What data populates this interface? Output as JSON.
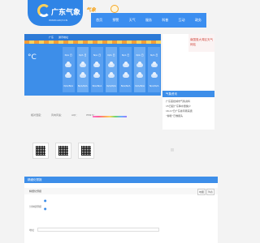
{
  "header": {
    "logo_text": "广东气象",
    "logo_url": "WWW.GDQY.CN",
    "promo_text": "气象"
  },
  "nav": {
    "items": [
      {
        "label": "首页"
      },
      {
        "label": "预警"
      },
      {
        "label": "天气"
      },
      {
        "label": "服务"
      },
      {
        "label": "科普"
      },
      {
        "label": "互动"
      },
      {
        "label": "政务"
      }
    ]
  },
  "weather": {
    "location": "广东",
    "location_sub": "通讯地址",
    "temperature": "°C",
    "columns": [
      {
        "top": "N/A 日",
        "bottom": "N/A/N/A"
      },
      {
        "top": "N/A 日",
        "bottom": "N/A/N/A"
      },
      {
        "top": "N/A 日",
        "bottom": "N/A/N/A"
      },
      {
        "top": "N/A 日",
        "bottom": "N/A/N/A"
      },
      {
        "top": "N/A 日",
        "bottom": "N/A/N/A"
      },
      {
        "top": "N/A 日",
        "bottom": "N/A/N/A"
      },
      {
        "top": "N/A 日",
        "bottom": "N/A/N/A"
      }
    ]
  },
  "info_row": {
    "item1": "相对湿度：",
    "item2": "风向风速：",
    "item3": "AQI：",
    "item4": "PM2.5："
  },
  "right": {
    "banner": "南国惠大湾区天气网站",
    "head": "气象资讯",
    "items": [
      "广东首批城市气象资料",
      "15日起广东降水量偏少",
      "16-17日广东春风雨来袭",
      "“春暖”已卷报头"
    ]
  },
  "qr": {
    "label1": "",
    "label2": "",
    "label3": ""
  },
  "bottom": {
    "head": "精细化预报",
    "tab": "精细化预报",
    "btn1": "地图",
    "btn2": "列表",
    "side": "分钟级预报",
    "field": "地址"
  }
}
